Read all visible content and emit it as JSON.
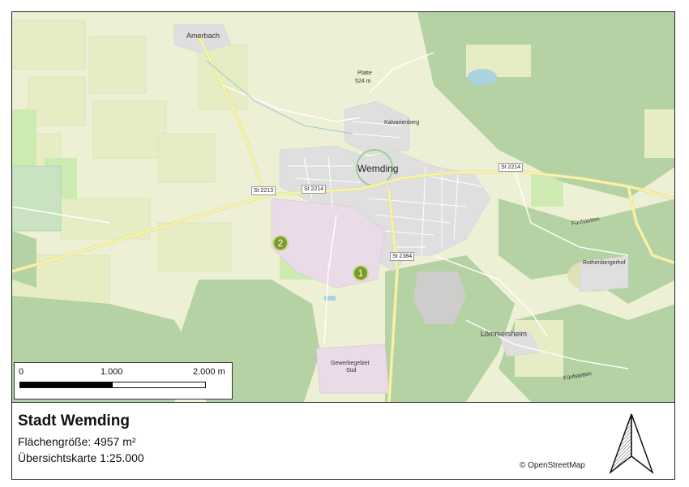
{
  "info": {
    "title": "Stadt Wemding",
    "area_label": "Flächengröße: 4957 m²",
    "scale_note": "Übersichtskarte 1:25.000",
    "copyright": "© OpenStreetMap"
  },
  "scalebar": {
    "labels": [
      "0",
      "1.000",
      "2.000 m"
    ]
  },
  "map_labels": {
    "town": "Wemding",
    "amerbach": "Amerbach",
    "platte": "Platte",
    "platte_elev": "524 m",
    "kalvarienberg": "Kalvarienberg",
    "lommersheim": "Lömmersheim",
    "rothenbergerhof": "Rothenbergerhof",
    "gewerbegebiet": "Gewerbegebiet",
    "sued": "Süd",
    "fuenfstetten_1": "Fünfstetten",
    "fuenfstetten_2": "Fünfstetten"
  },
  "roads": {
    "st2213": "St 2213",
    "st2214_a": "St 2214",
    "st2214_b": "St 2214",
    "st2384": "St 2384"
  },
  "markers": {
    "m1": "1",
    "m2": "2"
  },
  "colors": {
    "forest": "#b4d2a4",
    "farmland": "#eef0d6",
    "meadow": "#cdebb0",
    "residential": "#e0dfdf",
    "industrial": "#ebdbe8",
    "road": "#f7f5a8",
    "marker": "#7a9a2a",
    "water": "#aad3df"
  }
}
